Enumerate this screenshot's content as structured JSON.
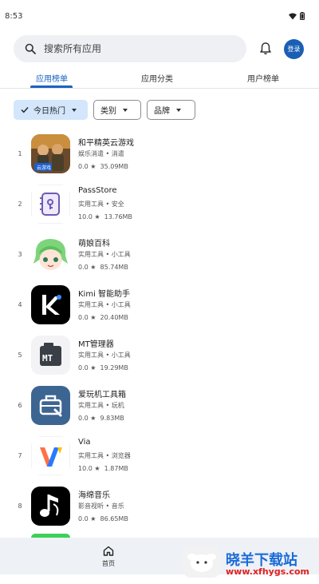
{
  "status_bar": {
    "time": "8:53"
  },
  "search": {
    "placeholder": "搜索所有应用",
    "login_label": "登录"
  },
  "tabs": [
    {
      "label": "应用榜单",
      "active": true
    },
    {
      "label": "应用分类",
      "active": false
    },
    {
      "label": "用户榜单",
      "active": false
    }
  ],
  "filters": [
    {
      "label": "今日热门",
      "selected": true
    },
    {
      "label": "类别",
      "selected": false
    },
    {
      "label": "品牌",
      "selected": false
    }
  ],
  "apps": [
    {
      "rank": "1",
      "name": "和平精英云游戏",
      "category": "娱乐消遣 • 消遣",
      "rating": "0.0 ★",
      "size": "35.09MB",
      "icon": "game-soldiers-icon"
    },
    {
      "rank": "2",
      "name": "PassStore",
      "category": "实用工具 • 安全",
      "rating": "10.0 ★",
      "size": "13.76MB",
      "icon": "notebook-lock-icon"
    },
    {
      "rank": "3",
      "name": "萌娘百科",
      "category": "实用工具 • 小工具",
      "rating": "0.0 ★",
      "size": "85.74MB",
      "icon": "anime-girl-icon"
    },
    {
      "rank": "4",
      "name": "Kimi 智能助手",
      "category": "实用工具 • 小工具",
      "rating": "0.0 ★",
      "size": "20.40MB",
      "icon": "kimi-k-icon"
    },
    {
      "rank": "5",
      "name": "MT管理器",
      "category": "实用工具 • 小工具",
      "rating": "0.0 ★",
      "size": "19.29MB",
      "icon": "mt-manager-icon"
    },
    {
      "rank": "6",
      "name": "爱玩机工具箱",
      "category": "实用工具 • 玩机",
      "rating": "0.0 ★",
      "size": "9.83MB",
      "icon": "toolbox-wrench-icon"
    },
    {
      "rank": "7",
      "name": "Via",
      "category": "实用工具 • 浏览器",
      "rating": "10.0 ★",
      "size": "1.87MB",
      "icon": "via-browser-icon"
    },
    {
      "rank": "8",
      "name": "海绵音乐",
      "category": "影音视听 • 音乐",
      "rating": "0.0 ★",
      "size": "86.65MB",
      "icon": "music-note-icon"
    }
  ],
  "bottom_nav": {
    "home_label": "首页"
  },
  "watermark": {
    "title": "晓羊下载站",
    "url": "www.xfhygs.com"
  },
  "colors": {
    "accent": "#1a63c0",
    "login_bg": "#1a5fb4",
    "chip_selected": "#d3e6fb",
    "nav_bg": "#eef1f6"
  }
}
